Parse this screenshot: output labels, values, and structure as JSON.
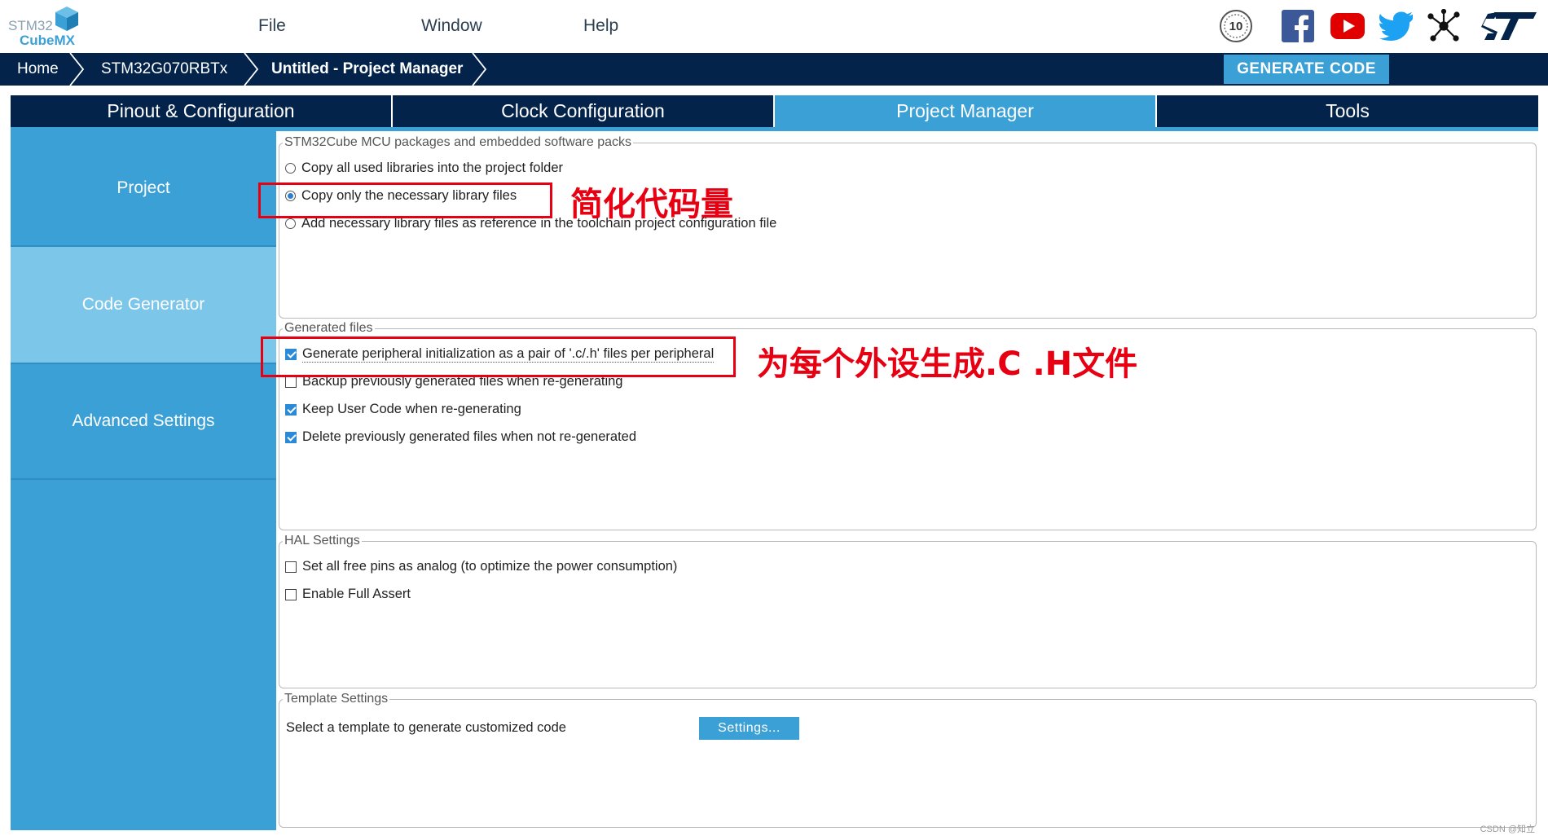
{
  "logo": {
    "line1": "STM32",
    "line2": "CubeMX"
  },
  "menu": {
    "file": "File",
    "window": "Window",
    "help": "Help"
  },
  "social": {
    "anniversary": "10",
    "icons": [
      "anniversary-10-icon",
      "facebook-icon",
      "youtube-icon",
      "twitter-icon",
      "network-icon",
      "st-logo-icon"
    ]
  },
  "breadcrumb": {
    "home": "Home",
    "mcu": "STM32G070RBTx",
    "project": "Untitled - Project Manager"
  },
  "generate_button": "GENERATE CODE",
  "tabs": [
    "Pinout & Configuration",
    "Clock Configuration",
    "Project Manager",
    "Tools"
  ],
  "active_tab": "Project Manager",
  "sidebar": {
    "items": [
      "Project",
      "Code Generator",
      "Advanced Settings"
    ],
    "active": "Code Generator"
  },
  "packages": {
    "legend": "STM32Cube MCU packages and embedded software packs",
    "options": [
      {
        "label": "Copy all used libraries into the project folder",
        "selected": false
      },
      {
        "label": "Copy only the necessary library files",
        "selected": true
      },
      {
        "label": "Add necessary library files as reference in the toolchain project configuration file",
        "selected": false
      }
    ]
  },
  "generated_files": {
    "legend": "Generated files",
    "options": [
      {
        "label": "Generate peripheral initialization as a pair of '.c/.h' files per peripheral",
        "checked": true
      },
      {
        "label": "Backup previously generated files when re-generating",
        "checked": false
      },
      {
        "label": "Keep User Code when re-generating",
        "checked": true
      },
      {
        "label": "Delete previously generated files when not re-generated",
        "checked": true
      }
    ]
  },
  "hal": {
    "legend": "HAL Settings",
    "options": [
      {
        "label": "Set all free pins as analog (to optimize the power consumption)",
        "checked": false
      },
      {
        "label": "Enable Full Assert",
        "checked": false
      }
    ]
  },
  "template": {
    "legend": "Template Settings",
    "text": "Select a template to generate customized code",
    "button": "Settings..."
  },
  "annotations": {
    "first": "简化代码量",
    "second": "为每个外设生成.C .H文件"
  },
  "colors": {
    "navy": "#03234b",
    "accent": "#3aa0d5",
    "annotation_red": "#e60012"
  },
  "watermark": "CSDN @知立"
}
